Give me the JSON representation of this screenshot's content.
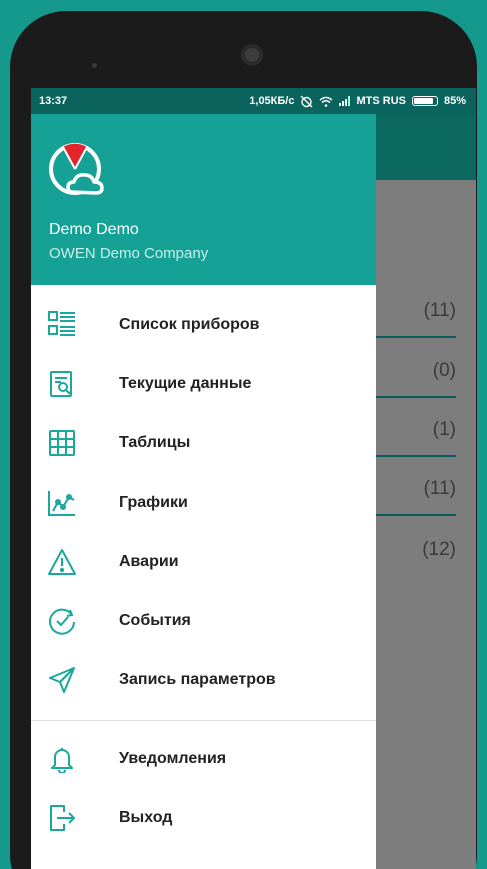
{
  "status_bar": {
    "time": "13:37",
    "speed": "1,05КБ/с",
    "carrier": "MTS RUS",
    "battery": "85%"
  },
  "background_list": {
    "counts": [
      "(11)",
      "(0)",
      "(1)",
      "(11)",
      "(12)"
    ]
  },
  "drawer": {
    "user_name": "Demo Demo",
    "company": "OWEN Demo Company",
    "items": [
      {
        "label": "Список приборов",
        "icon": "device-list-icon"
      },
      {
        "label": "Текущие данные",
        "icon": "current-data-icon"
      },
      {
        "label": "Таблицы",
        "icon": "table-icon"
      },
      {
        "label": "Графики",
        "icon": "chart-icon"
      },
      {
        "label": "Аварии",
        "icon": "warning-icon"
      },
      {
        "label": "События",
        "icon": "clock-check-icon"
      },
      {
        "label": "Запись параметров",
        "icon": "send-icon"
      }
    ],
    "bottom_items": [
      {
        "label": "Уведомления",
        "icon": "bell-icon"
      },
      {
        "label": "Выход",
        "icon": "logout-icon"
      }
    ]
  },
  "colors": {
    "accent": "#15a196",
    "icon": "#1aa89c",
    "logo_red": "#e3262e"
  }
}
